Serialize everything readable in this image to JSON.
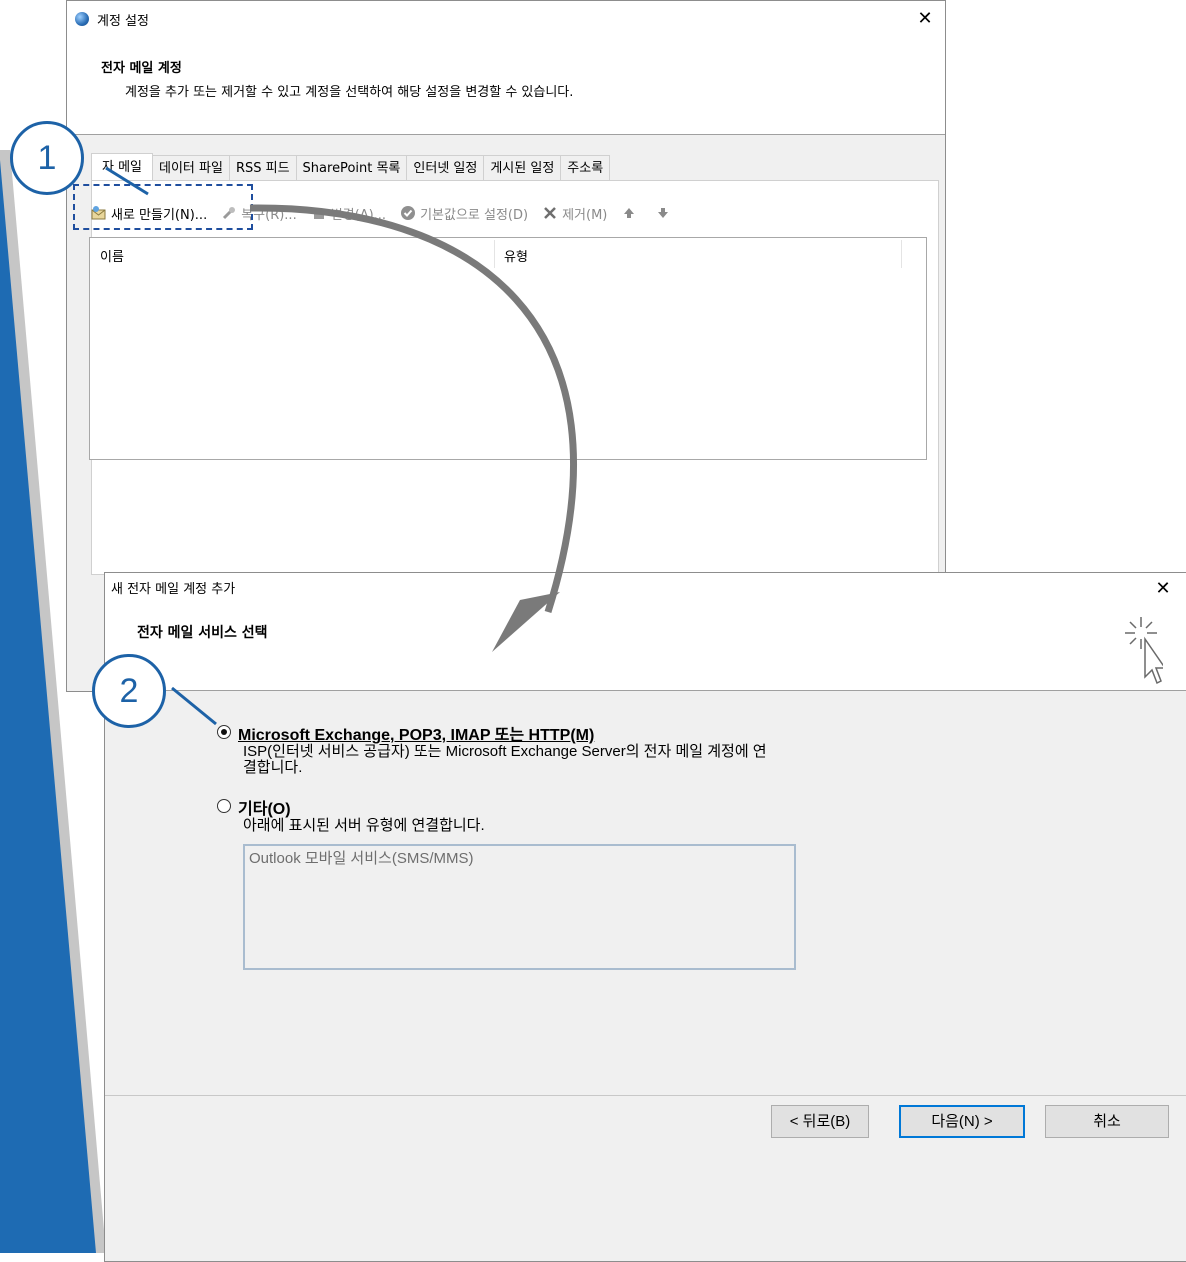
{
  "account_settings": {
    "title": "계정 설정",
    "header_title": "전자 메일 계정",
    "header_desc": "계정을 추가 또는 제거할 수 있고 계정을 선택하여 해당 설정을 변경할 수 있습니다.",
    "close": "✕",
    "tabs": [
      "자 메일",
      "데이터 파일",
      "RSS 피드",
      "SharePoint 목록",
      "인터넷 일정",
      "게시된 일정",
      "주소록"
    ],
    "toolbar": {
      "new": "새로 만들기(N)...",
      "repair": "복구(R)...",
      "change": "변경(A)...",
      "set_default": "기본값으로 설정(D)",
      "remove": "제거(M)",
      "up": "🠉",
      "down": "🠋"
    },
    "columns": [
      "이름",
      "유형"
    ]
  },
  "new_account": {
    "title": "새 전자 메일 계정 추가",
    "close": "✕",
    "header_title": "전자 메일 서비스 선택",
    "option1": {
      "label": "Microsoft Exchange, POP3, IMAP 또는 HTTP(M)",
      "desc_line1": "ISP(인터넷 서비스 공급자) 또는 Microsoft Exchange Server의 전자 메일 계정에 연",
      "desc_line2": "결합니다.",
      "selected": true
    },
    "option2": {
      "label": "기타(O)",
      "desc": "아래에 표시된 서버 유형에 연결합니다.",
      "selected": false,
      "services": [
        "Outlook 모바일 서비스(SMS/MMS)"
      ]
    },
    "buttons": {
      "back": "< 뒤로(B)",
      "next": "다음(N) >",
      "cancel": "취소"
    }
  },
  "callouts": {
    "step1": "1",
    "step2": "2"
  },
  "colors": {
    "callout_blue": "#1d62a7",
    "accent_wedge": "#1e6bb3",
    "dashed_box": "#1f4e9e",
    "arrow_gray": "#7a7a7a"
  }
}
